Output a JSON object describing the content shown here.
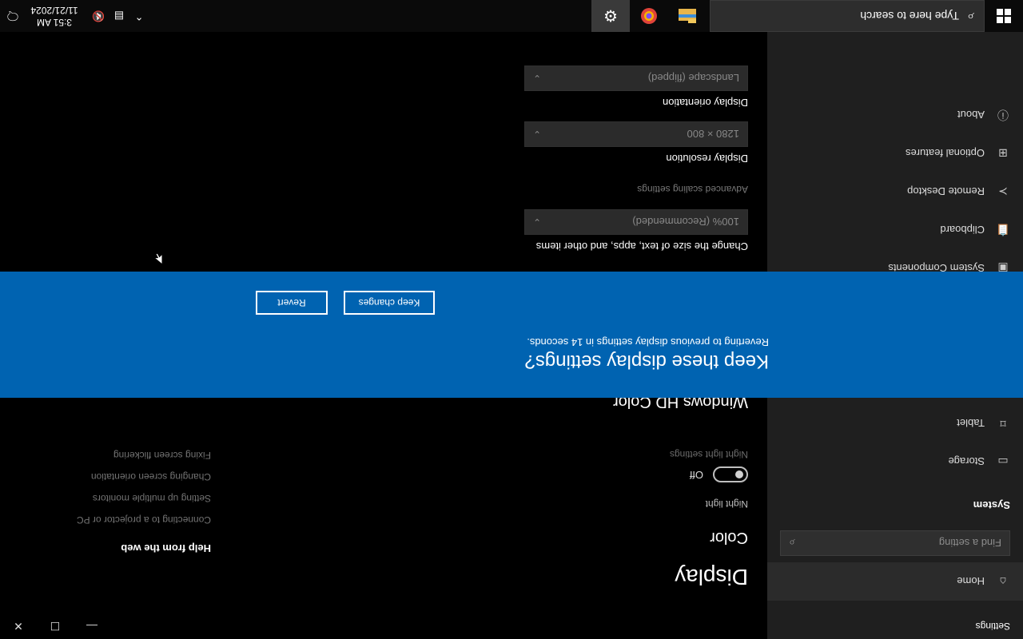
{
  "window": {
    "title": "Settings",
    "controls": {
      "minimize_icon": "minimize-icon",
      "maximize_icon": "maximize-icon",
      "close_icon": "close-icon"
    }
  },
  "sidebar": {
    "home_label": "Home",
    "search_placeholder": "Find a setting",
    "group_title": "System",
    "items": [
      {
        "label": "Storage",
        "icon": "storage-icon"
      },
      {
        "label": "Tablet",
        "icon": "tablet-icon"
      },
      {
        "label": "System Components",
        "icon": "components-icon"
      },
      {
        "label": "Clipboard",
        "icon": "clipboard-icon"
      },
      {
        "label": "Remote Desktop",
        "icon": "remote-desktop-icon"
      },
      {
        "label": "Optional features",
        "icon": "optional-features-icon"
      },
      {
        "label": "About",
        "icon": "about-icon"
      }
    ]
  },
  "main": {
    "title": "Display",
    "color_title": "Color",
    "night_light_label": "Night light",
    "night_light_state": "Off",
    "night_light_settings": "Night light settings",
    "hdr_title": "Windows HD Color",
    "scale_label": "Change the size of text, apps, and other items",
    "scale_value": "100% (Recommended)",
    "advanced_scaling": "Advanced scaling settings",
    "resolution_label": "Display resolution",
    "resolution_value": "1280 × 800",
    "orientation_label": "Display orientation",
    "orientation_value": "Landscape (flipped)"
  },
  "help": {
    "title": "Help from the web",
    "links": [
      "Connecting to a projector or PC",
      "Setting up multiple monitors",
      "Changing screen orientation",
      "Fixing screen flickering"
    ]
  },
  "dialog": {
    "title": "Keep these display settings?",
    "message": "Reverting to previous display settings in 14 seconds.",
    "keep_label": "Keep changes",
    "revert_label": "Revert"
  },
  "taskbar": {
    "search_placeholder": "Type here to search",
    "clock_time": "3:51 AM",
    "clock_date": "11/21/2024"
  },
  "colors": {
    "accent": "#0063b1",
    "sidebar_bg": "#1f1f1f",
    "content_bg": "#000000"
  }
}
